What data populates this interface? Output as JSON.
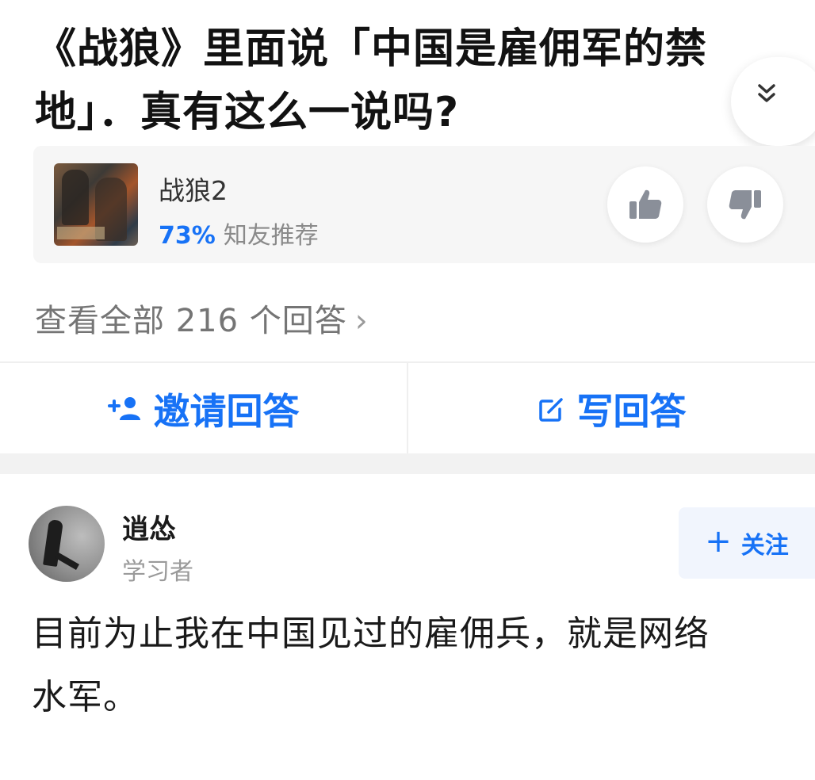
{
  "question": {
    "title_line1": "《战狼》里面说「中国是雇佣军的禁",
    "title_line2": "地」．真有这么一说吗?"
  },
  "collapse_icon": "double-chevron-down-icon",
  "movie": {
    "name": "战狼2",
    "rating_percent": "73%",
    "rating_label": "知友推荐",
    "poster_icon": "movie-poster",
    "vote_up_icon": "thumbs-up-icon",
    "vote_down_icon": "thumbs-down-icon"
  },
  "view_all": {
    "label": "查看全部 216 个回答",
    "chevron": "›"
  },
  "actions": {
    "invite_label": "邀请回答",
    "invite_icon": "add-user-icon",
    "write_label": "写回答",
    "write_icon": "edit-icon"
  },
  "answer": {
    "author_name": "逍怂",
    "author_bio": "学习者",
    "follow_label": "关注",
    "follow_plus": "+",
    "body_line1": "目前为止我在中国见过的雇佣兵，就是网络",
    "body_line2": "水军。"
  },
  "colors": {
    "accent": "#1772f6",
    "text": "#1a1a1a",
    "muted": "#8a8a8a"
  }
}
